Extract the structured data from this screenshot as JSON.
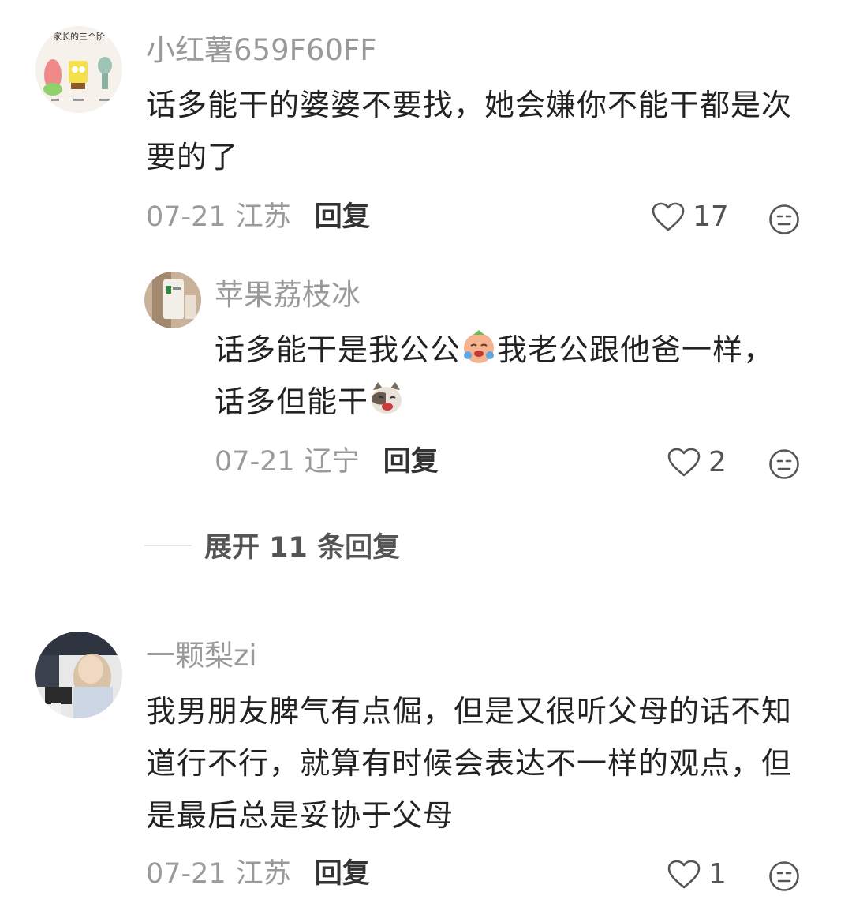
{
  "comments": [
    {
      "username": "小红薯659F60FF",
      "avatar": {
        "caption": "家长的三个阶"
      },
      "text": "话多能干的婆婆不要找，她会嫌你不能干都是次要的了",
      "time": "07-21",
      "location": "江苏",
      "reply_label": "回复",
      "likes": "17",
      "replies": [
        {
          "username": "苹果荔枝冰",
          "text_part1": "话多能干是我公公",
          "emoji1": "crying-face-emoji",
          "text_part2": "我老公跟他爸一样，",
          "text_part3": "话多但能干",
          "emoji2": "cat-crying-emoji",
          "time": "07-21",
          "location": "辽宁",
          "reply_label": "回复",
          "likes": "2"
        }
      ],
      "expand_label": "展开 11 条回复"
    },
    {
      "username": "一颗梨zi",
      "text": "我男朋友脾气有点倔，但是又很听父母的话不知道行不行，就算有时候会表达不一样的观点，但是最后总是妥协于父母",
      "time": "07-21",
      "location": "江苏",
      "reply_label": "回复",
      "likes": "1"
    }
  ],
  "icons": {
    "like": "heart-outline-icon",
    "more": "face-icon"
  },
  "colors": {
    "text": "#222222",
    "muted": "#9a9a9a",
    "reply": "#333333"
  }
}
